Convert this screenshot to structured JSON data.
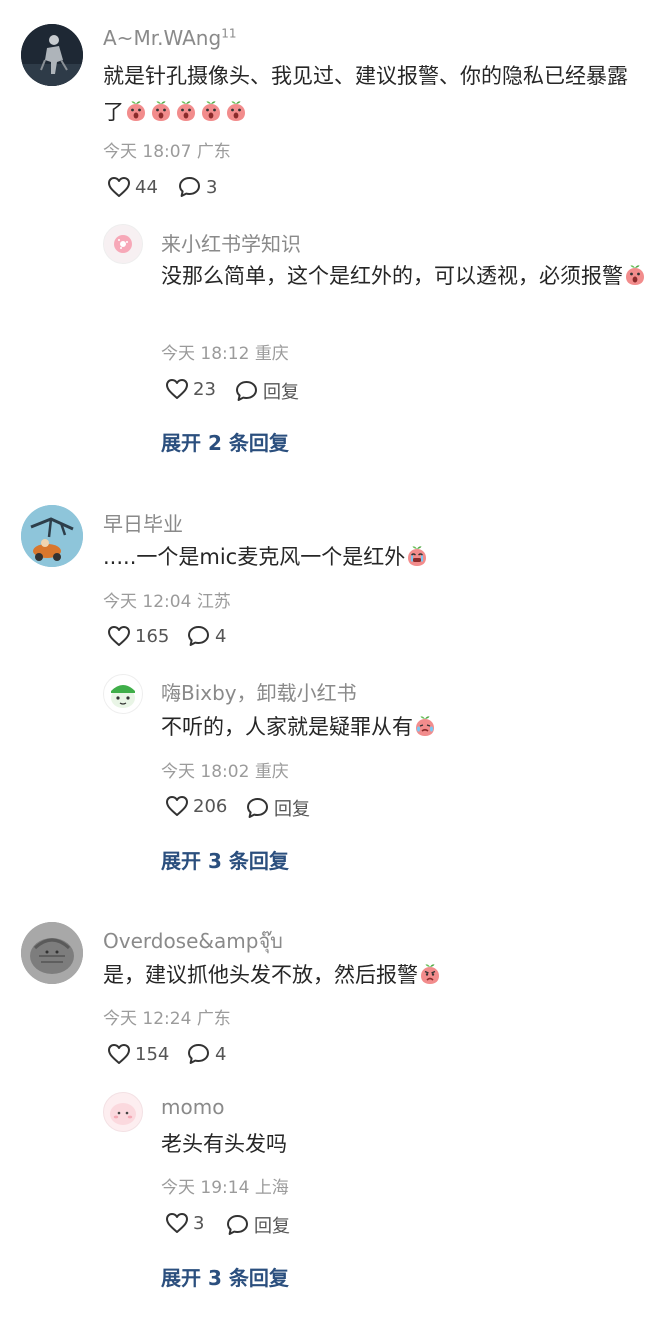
{
  "comments": [
    {
      "username": "A~Mr.WAng",
      "badge": "11",
      "text": "就是针孔摄像头、我见过、建议报警、你的隐私已经暴露了",
      "time": "今天 18:07",
      "location": "广东",
      "likes": "44",
      "replies_count": "3",
      "emoji_icons": [
        "peach-shock-emoji",
        "peach-shock-emoji",
        "peach-shock-emoji",
        "peach-shock-emoji",
        "peach-shock-emoji"
      ],
      "reply": {
        "username": "来小红书学知识",
        "text": "没那么简单，这个是红外的，可以透视，必须报警",
        "time": "今天 18:12",
        "location": "重庆",
        "likes": "23",
        "reply_label": "回复",
        "emoji_icons": [
          "peach-shock-emoji"
        ]
      },
      "expand_label": "展开 2 条回复"
    },
    {
      "username": "早日毕业",
      "text": ".....一个是mic麦克风一个是红外",
      "time": "今天 12:04",
      "location": "江苏",
      "likes": "165",
      "replies_count": "4",
      "emoji_icons": [
        "crying-face-emoji"
      ],
      "reply": {
        "username": "嗨Bixby，卸载小红书",
        "text": "不听的，人家就是疑罪从有",
        "time": "今天 18:02",
        "location": "重庆",
        "likes": "206",
        "reply_label": "回复",
        "emoji_icons": [
          "sweat-cry-emoji"
        ]
      },
      "expand_label": "展开 3 条回复"
    },
    {
      "username": "Overdose&ampจุ๊บ",
      "text": "是，建议抓他头发不放，然后报警",
      "time": "今天 12:24",
      "location": "广东",
      "likes": "154",
      "replies_count": "4",
      "emoji_icons": [
        "angry-peach-emoji"
      ],
      "reply": {
        "username": "momo",
        "text": "老头有头发吗",
        "time": "今天 19:14",
        "location": "上海",
        "likes": "3",
        "reply_label": "回复",
        "emoji_icons": []
      },
      "expand_label": "展开 3 条回复"
    }
  ],
  "colors": {
    "username": "#8a8a8a",
    "body_text": "#262626",
    "meta": "#9b9b9b",
    "expand_link": "#2b4f7e",
    "emoji_peach": "#f28c8c"
  }
}
